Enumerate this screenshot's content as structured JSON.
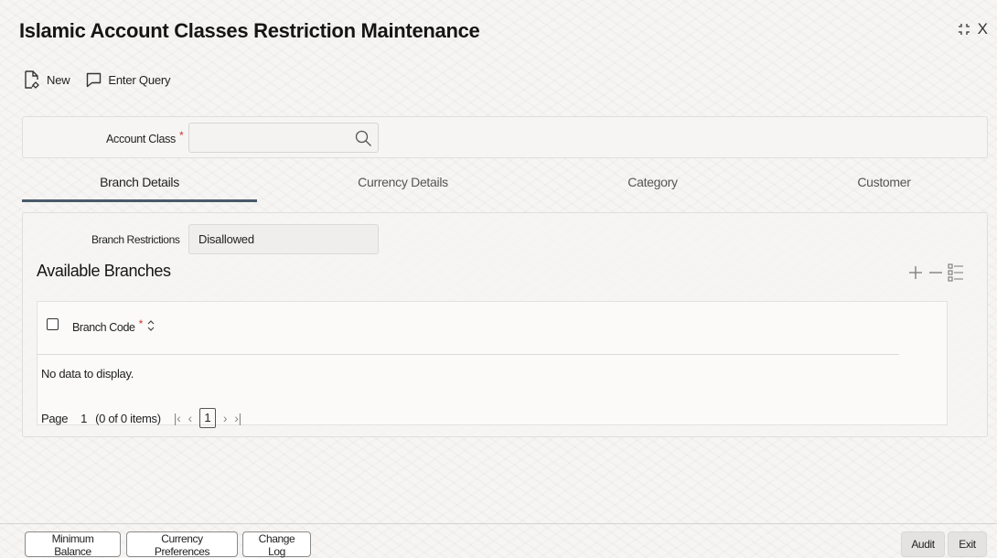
{
  "window": {
    "title": "Islamic Account Classes Restriction Maintenance",
    "close_glyph": "X"
  },
  "toolbar": {
    "new_label": "New",
    "enter_query_label": "Enter Query"
  },
  "query": {
    "account_class_label": "Account Class",
    "required_mark": "*",
    "account_class_value": ""
  },
  "tabs": [
    {
      "label": "Branch Details",
      "active": true
    },
    {
      "label": "Currency Details",
      "active": false
    },
    {
      "label": "Category",
      "active": false
    },
    {
      "label": "Customer",
      "active": false
    }
  ],
  "branch": {
    "restrictions_label": "Branch Restrictions",
    "restrictions_value": "Disallowed",
    "section_title": "Available Branches",
    "columns": [
      {
        "label": "Branch Code",
        "required_mark": "*"
      }
    ],
    "rows": [],
    "empty_message": "No data to display.",
    "pagination": {
      "page_label": "Page",
      "page_number": "1",
      "items_text": "(0 of 0 items)",
      "current_page": "1",
      "first_glyph": "|‹",
      "prev_glyph": "‹",
      "next_glyph": "›",
      "last_glyph": "›|"
    }
  },
  "footer": {
    "minimum_balance": "Minimum Balance",
    "currency_preferences": "Currency Preferences",
    "change_log": "Change Log",
    "audit": "Audit",
    "exit": "Exit"
  },
  "colors": {
    "tab_underline": "#4a5a6a",
    "required": "#d0312d",
    "background": "#f6f5f3"
  }
}
